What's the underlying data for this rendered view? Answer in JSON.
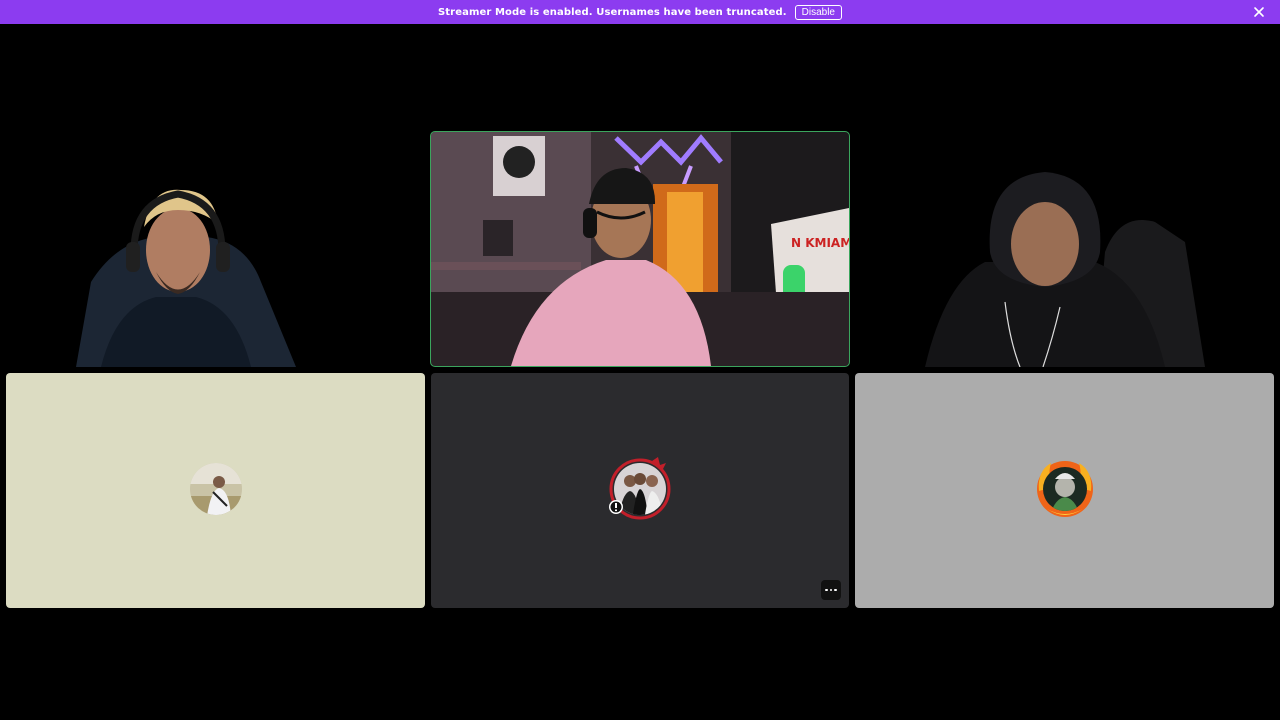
{
  "banner": {
    "message": "Streamer Mode is enabled. Usernames have been truncated.",
    "disable_label": "Disable",
    "background": "#8c3cf0"
  },
  "tiles": {
    "left_video": {
      "kind": "camera"
    },
    "center_video": {
      "kind": "camera",
      "speaking": true,
      "border_color": "#3ba55d"
    },
    "right_video": {
      "kind": "camera"
    },
    "bottom_left": {
      "kind": "avatar",
      "background": "#dcdcc2"
    },
    "bottom_center": {
      "kind": "avatar",
      "background": "#2b2b2e",
      "more_icon": "more-horizontal-icon"
    },
    "bottom_right": {
      "kind": "avatar",
      "background": "#acacac"
    }
  }
}
